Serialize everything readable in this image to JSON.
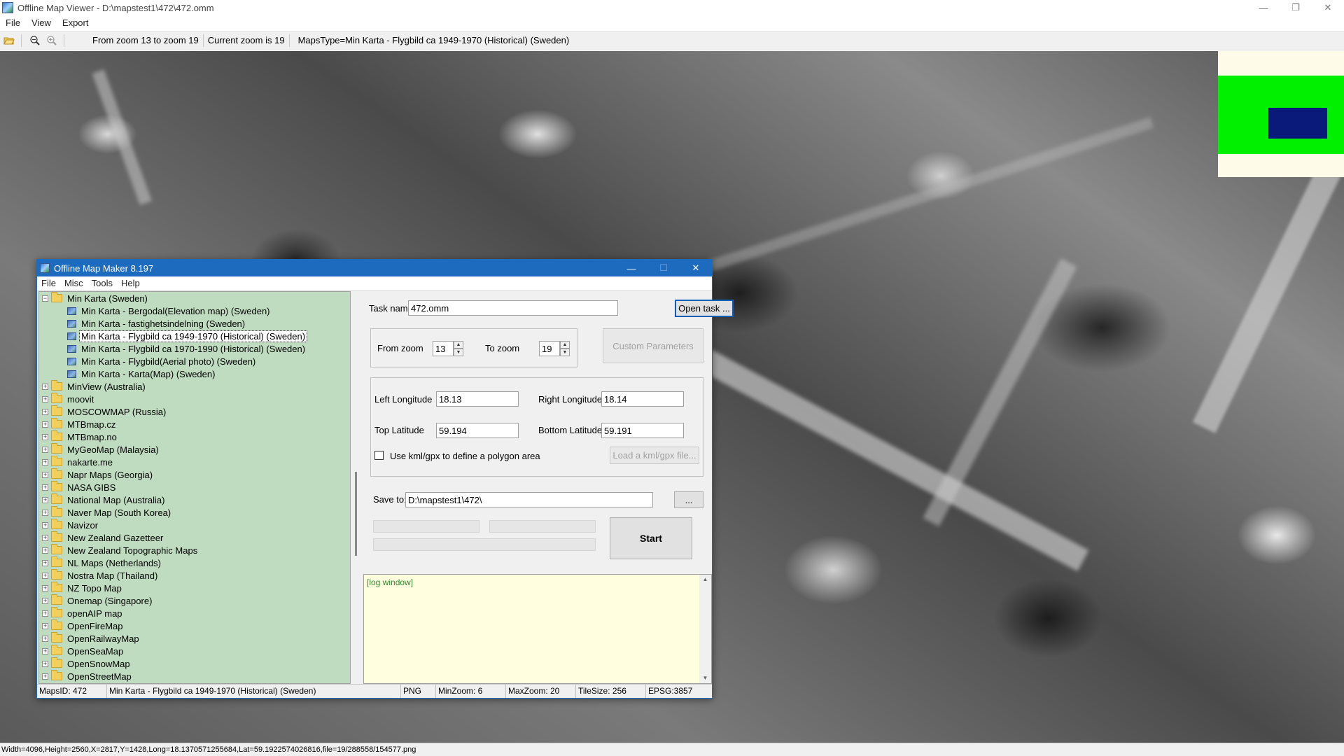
{
  "window": {
    "title": "Offline Map Viewer - D:\\mapstest1\\472\\472.omm",
    "controls": {
      "minimize": "—",
      "restore": "❐",
      "close": "✕"
    }
  },
  "menu": [
    "File",
    "View",
    "Export"
  ],
  "toolbar": {
    "zoom_range": "From zoom 13 to zoom 19",
    "current_zoom": "Current zoom is 19",
    "maps_type": "MapsType=Min Karta - Flygbild ca 1949-1970 (Historical) (Sweden)"
  },
  "overview_colors": {
    "background": "#fffbe9",
    "region": "#00f000",
    "viewport": "#0a1a7a"
  },
  "status_bar": "Width=4096,Height=2560,X=2817,Y=1428,Long=18.1370571255684,Lat=59.1922574026816,file=19/288558/154577.png",
  "dialog": {
    "title": "Offline Map Maker 8.197",
    "controls": {
      "minimize": "—",
      "maximize": "☐",
      "close": "✕"
    },
    "menu": [
      "File",
      "Misc",
      "Tools",
      "Help"
    ],
    "tree": {
      "root": {
        "label": "Min Karta (Sweden)",
        "expander": "−"
      },
      "children": [
        {
          "label": "Min Karta - Bergodal(Elevation map) (Sweden)",
          "selected": false
        },
        {
          "label": "Min Karta - fastighetsindelning (Sweden)",
          "selected": false
        },
        {
          "label": "Min Karta - Flygbild ca 1949-1970 (Historical) (Sweden)",
          "selected": true
        },
        {
          "label": "Min Karta - Flygbild ca 1970-1990 (Historical) (Sweden)",
          "selected": false
        },
        {
          "label": "Min Karta - Flygbild(Aerial photo) (Sweden)",
          "selected": false
        },
        {
          "label": "Min Karta - Karta(Map) (Sweden)",
          "selected": false
        }
      ],
      "folders": [
        "MinView (Australia)",
        "moovit",
        "MOSCOWMAP (Russia)",
        "MTBmap.cz",
        "MTBmap.no",
        "MyGeoMap (Malaysia)",
        "nakarte.me",
        "Napr Maps (Georgia)",
        "NASA GIBS",
        "National Map (Australia)",
        "Naver Map (South Korea)",
        "Navizor",
        "New Zealand Gazetteer",
        "New Zealand Topographic Maps",
        "NL Maps (Netherlands)",
        "Nostra Map (Thailand)",
        "NZ Topo Map",
        "Onemap (Singapore)",
        "openAIP map",
        "OpenFireMap",
        "OpenRailwayMap",
        "OpenSeaMap",
        "OpenSnowMap",
        "OpenStreetMap"
      ],
      "expander_collapsed": "+"
    },
    "form": {
      "task_name_label": "Task name",
      "task_name_value": "472.omm",
      "open_task_button": "Open task ...",
      "from_zoom_label": "From zoom",
      "from_zoom_value": "13",
      "to_zoom_label": "To zoom",
      "to_zoom_value": "19",
      "spin_up": "▲",
      "spin_down": "▼",
      "custom_params_button": "Custom Parameters",
      "left_lon_label": "Left Longitude",
      "left_lon_value": "18.13",
      "right_lon_label": "Right Longitude",
      "right_lon_value": "18.14",
      "top_lat_label": "Top Latitude",
      "top_lat_value": "59.194",
      "bottom_lat_label": "Bottom Latitude",
      "bottom_lat_value": "59.191",
      "kml_checkbox_label": "Use kml/gpx to define a polygon area",
      "kml_checkbox_checked": false,
      "load_kml_button": "Load a kml/gpx file...",
      "save_to_label": "Save to:",
      "save_to_value": "D:\\mapstest1\\472\\",
      "browse_button": "...",
      "start_button": "Start"
    },
    "log": {
      "text": "[log window]",
      "scroll_up": "▲",
      "scroll_down": "▼"
    },
    "status": {
      "maps_id": "MapsID: 472",
      "map_name": "Min Karta - Flygbild ca 1949-1970 (Historical) (Sweden)",
      "format": "PNG",
      "min_zoom": "MinZoom: 6",
      "max_zoom": "MaxZoom: 20",
      "tile_size": "TileSize: 256",
      "epsg": "EPSG:3857"
    }
  }
}
